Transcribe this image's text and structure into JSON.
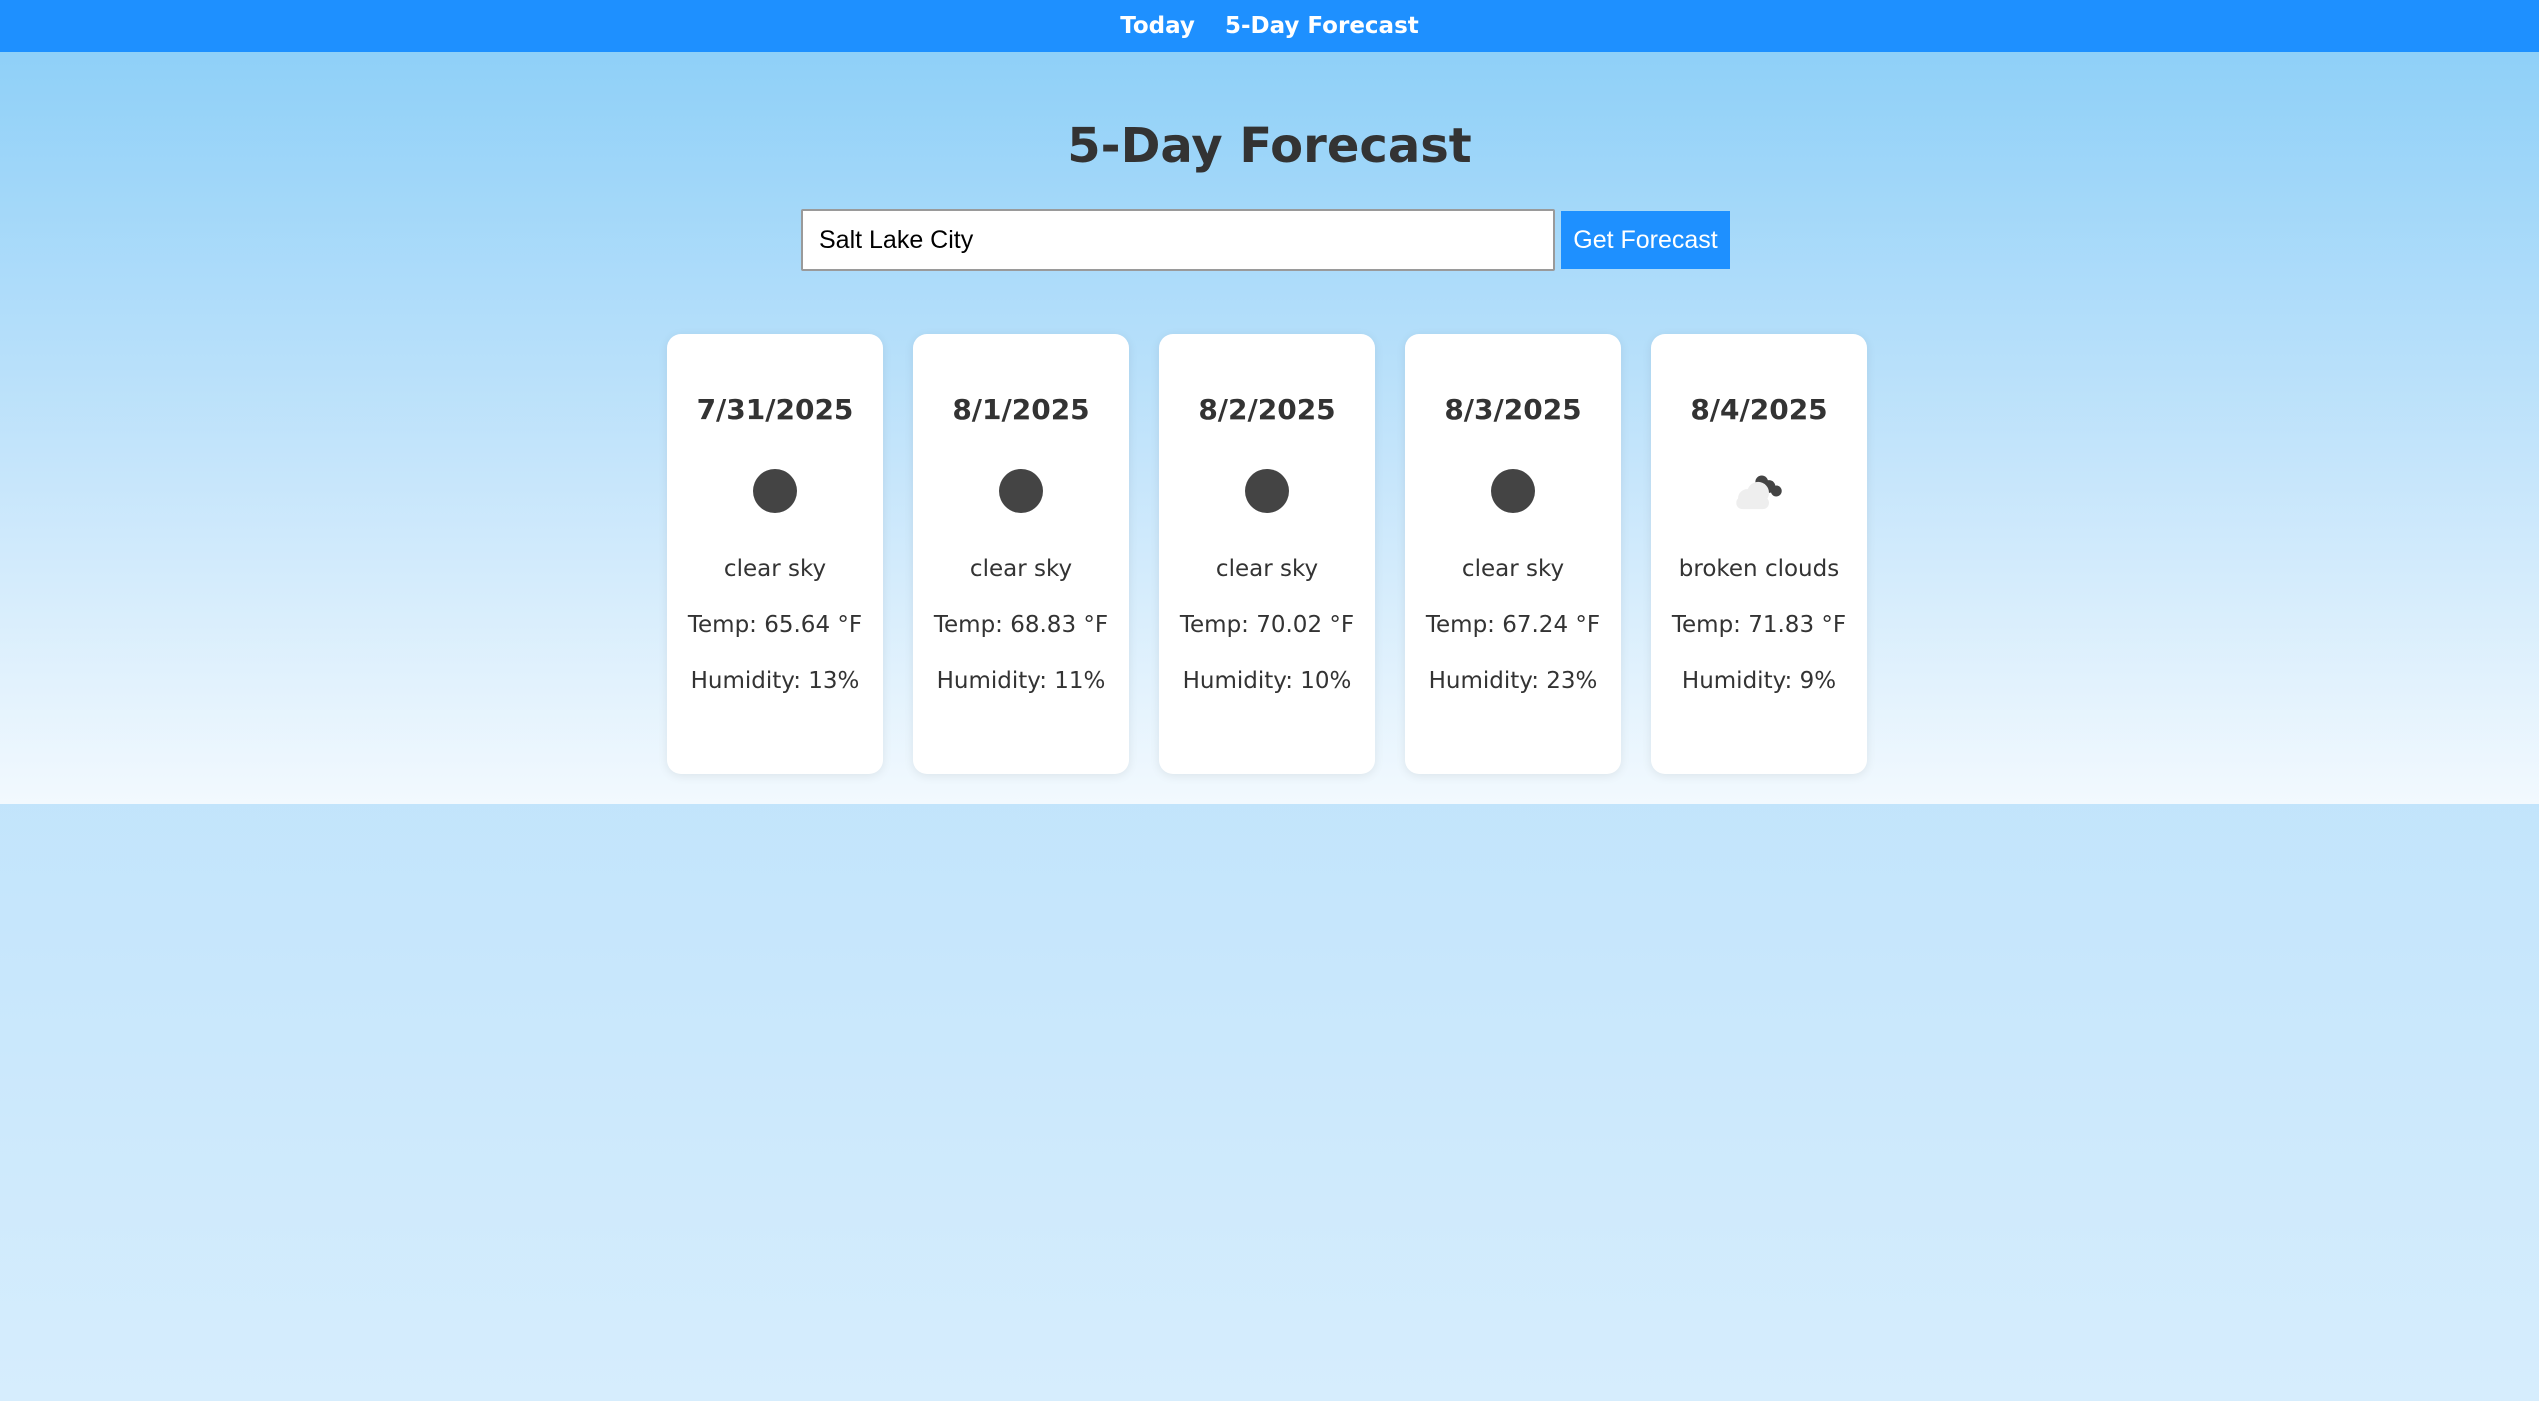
{
  "nav": {
    "items": [
      {
        "label": "Today"
      },
      {
        "label": "5-Day Forecast"
      }
    ]
  },
  "page": {
    "title": "5-Day Forecast"
  },
  "search": {
    "value": "Salt Lake City",
    "button_label": "Get Forecast"
  },
  "forecast": [
    {
      "date": "7/31/2025",
      "icon": "clear-sky-icon",
      "description": "clear sky",
      "temp": "Temp: 65.64 °F",
      "humidity": "Humidity: 13%"
    },
    {
      "date": "8/1/2025",
      "icon": "clear-sky-icon",
      "description": "clear sky",
      "temp": "Temp: 68.83 °F",
      "humidity": "Humidity: 11%"
    },
    {
      "date": "8/2/2025",
      "icon": "clear-sky-icon",
      "description": "clear sky",
      "temp": "Temp: 70.02 °F",
      "humidity": "Humidity: 10%"
    },
    {
      "date": "8/3/2025",
      "icon": "clear-sky-icon",
      "description": "clear sky",
      "temp": "Temp: 67.24 °F",
      "humidity": "Humidity: 23%"
    },
    {
      "date": "8/4/2025",
      "icon": "broken-clouds-icon",
      "description": "broken clouds",
      "temp": "Temp: 71.83 °F",
      "humidity": "Humidity: 9%"
    }
  ],
  "colors": {
    "accent": "#1e90ff",
    "text": "#333333",
    "icon_dark": "#444444"
  }
}
